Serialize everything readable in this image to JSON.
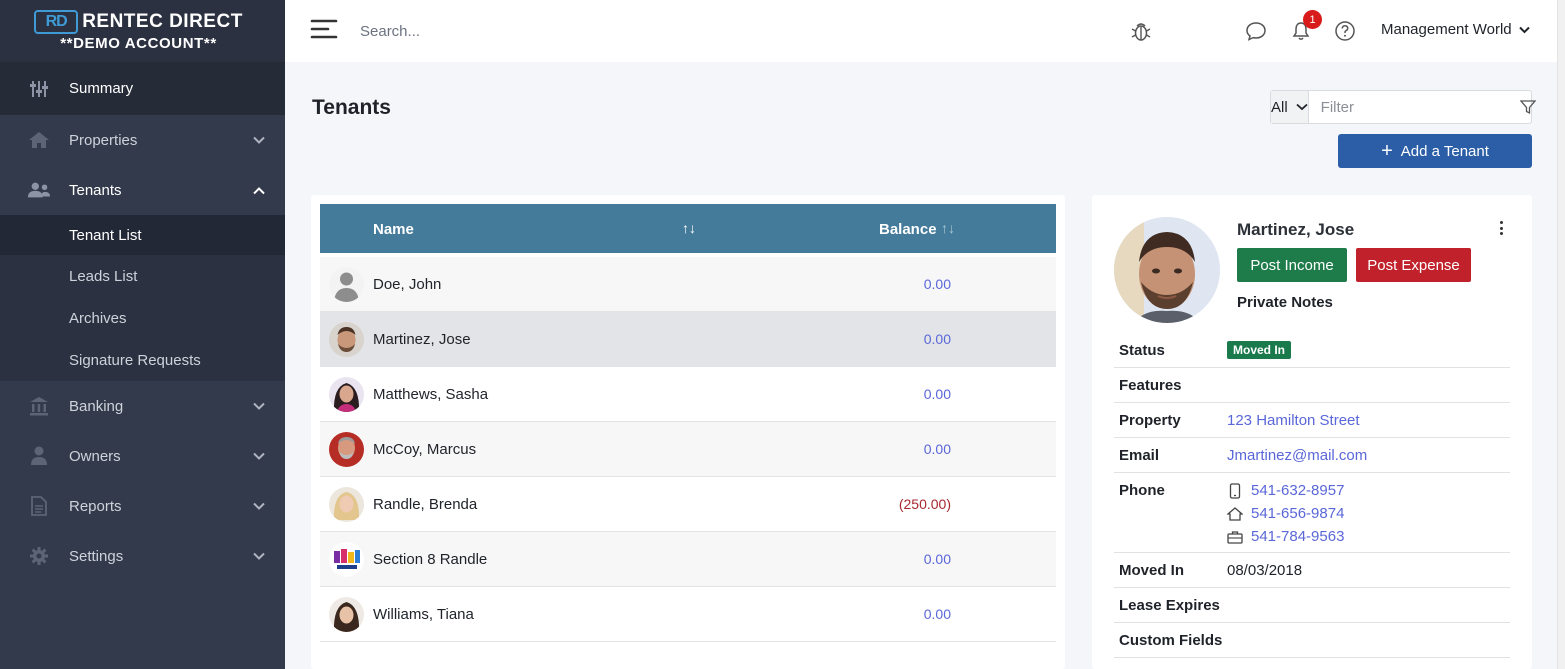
{
  "brand": {
    "mark": "RD",
    "name": "RENTEC DIRECT",
    "subtitle": "**DEMO ACCOUNT**"
  },
  "sidebar": {
    "items": [
      {
        "label": "Summary",
        "icon": "sliders-icon"
      },
      {
        "label": "Properties",
        "icon": "home-icon"
      },
      {
        "label": "Tenants",
        "icon": "users-icon"
      },
      {
        "label": "Banking",
        "icon": "bank-icon"
      },
      {
        "label": "Owners",
        "icon": "user-icon"
      },
      {
        "label": "Reports",
        "icon": "document-icon"
      },
      {
        "label": "Settings",
        "icon": "gear-icon"
      }
    ],
    "tenant_sub": [
      {
        "label": "Tenant List"
      },
      {
        "label": "Leads List"
      },
      {
        "label": "Archives"
      },
      {
        "label": "Signature Requests"
      }
    ]
  },
  "topbar": {
    "search_placeholder": "Search...",
    "notification_count": "1",
    "account_name": "Management World"
  },
  "page": {
    "title": "Tenants",
    "filter_scope": "All",
    "filter_placeholder": "Filter",
    "add_button": "Add a Tenant"
  },
  "table": {
    "headers": {
      "name": "Name",
      "sort_name": "↑↓",
      "balance": "Balance",
      "sort_balance": "↑↓"
    },
    "rows": [
      {
        "name": "Doe, John",
        "balance": "0.00"
      },
      {
        "name": "Martinez, Jose",
        "balance": "0.00"
      },
      {
        "name": "Matthews, Sasha",
        "balance": "0.00"
      },
      {
        "name": "McCoy, Marcus",
        "balance": "0.00"
      },
      {
        "name": "Randle, Brenda",
        "balance": "(250.00)"
      },
      {
        "name": "Section 8 Randle",
        "balance": "0.00"
      },
      {
        "name": "Williams, Tiana",
        "balance": "0.00"
      }
    ]
  },
  "detail": {
    "name": "Martinez, Jose",
    "post_income": "Post Income",
    "post_expense": "Post Expense",
    "private_notes": "Private Notes",
    "fields": {
      "status_label": "Status",
      "status_value": "Moved In",
      "features_label": "Features",
      "property_label": "Property",
      "property_value": "123 Hamilton Street",
      "email_label": "Email",
      "email_value": "Jmartinez@mail.com",
      "phone_label": "Phone",
      "phone_mobile": "541-632-8957",
      "phone_home": "541-656-9874",
      "phone_work": "541-784-9563",
      "moved_in_label": "Moved In",
      "moved_in_value": "08/03/2018",
      "lease_expires_label": "Lease Expires",
      "custom_fields_label": "Custom Fields"
    }
  },
  "colors": {
    "sidebar": "#333a4b",
    "table_header": "#447b9a",
    "primary": "#2b5ea6",
    "success": "#1e7c4a",
    "danger": "#c0212b",
    "link": "#5a67d8"
  }
}
